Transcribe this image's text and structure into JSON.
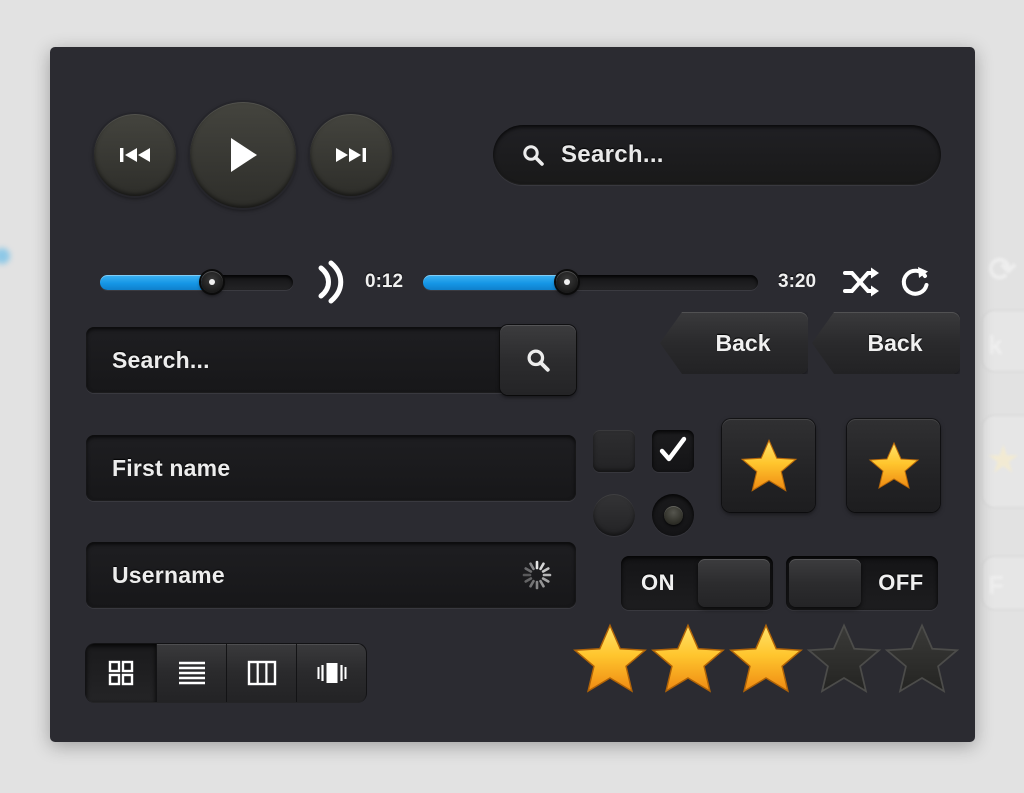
{
  "panel": {
    "background_color": "#2b2b31",
    "page_background_color": "#e2e2e2"
  },
  "accent": {
    "slider_blue": "#1596e6",
    "star_gold_top": "#ffd84d",
    "star_gold_bottom": "#f08a15"
  },
  "transport": {
    "previous": {
      "icon": "previous-track-icon",
      "label": "Previous"
    },
    "play": {
      "icon": "play-icon",
      "label": "Play"
    },
    "next": {
      "icon": "next-track-icon",
      "label": "Next"
    }
  },
  "top_search": {
    "icon": "search-icon",
    "placeholder": "Search...",
    "value": ""
  },
  "player": {
    "volume": {
      "icon": "volume-icon",
      "value_percent": 58
    },
    "elapsed_time": "0:12",
    "total_time": "3:20",
    "progress_percent": 43,
    "shuffle": {
      "icon": "shuffle-icon",
      "label": "Shuffle"
    },
    "repeat": {
      "icon": "repeat-icon",
      "label": "Repeat"
    }
  },
  "fields": {
    "search": {
      "placeholder": "Search...",
      "value": "",
      "button_icon": "search-icon"
    },
    "first_name": {
      "placeholder": "First name",
      "value": ""
    },
    "username": {
      "placeholder": "Username",
      "value": "",
      "status_icon": "loading-spinner-icon"
    }
  },
  "back_buttons": [
    {
      "label": "Back"
    },
    {
      "label": "Back"
    }
  ],
  "selection_controls": {
    "checkbox_unchecked": {
      "checked": false,
      "icon": "checkbox-icon"
    },
    "checkbox_checked": {
      "checked": true,
      "icon": "checkmark-icon"
    },
    "radio_unselected": {
      "selected": false,
      "icon": "radio-icon"
    },
    "radio_selected": {
      "selected": true,
      "icon": "radio-selected-icon"
    }
  },
  "star_buttons": [
    {
      "icon": "star-icon",
      "active": true
    },
    {
      "icon": "star-icon",
      "active": true
    }
  ],
  "toggles": [
    {
      "state_label": "ON",
      "knob_side": "right",
      "on": true
    },
    {
      "state_label": "OFF",
      "knob_side": "left",
      "on": false
    }
  ],
  "rating": {
    "value": 3,
    "max": 5,
    "stars": [
      true,
      true,
      true,
      false,
      false
    ]
  },
  "view_modes": [
    {
      "icon": "grid-view-icon",
      "label": "Grid",
      "active": true
    },
    {
      "icon": "list-view-icon",
      "label": "List",
      "active": false
    },
    {
      "icon": "column-view-icon",
      "label": "Columns",
      "active": false
    },
    {
      "icon": "coverflow-view-icon",
      "label": "Cover Flow",
      "active": false
    }
  ],
  "ghosts": {
    "repeat": "repeat-icon",
    "back_fragment": "k",
    "star": "star-icon",
    "off_fragment": "F"
  }
}
